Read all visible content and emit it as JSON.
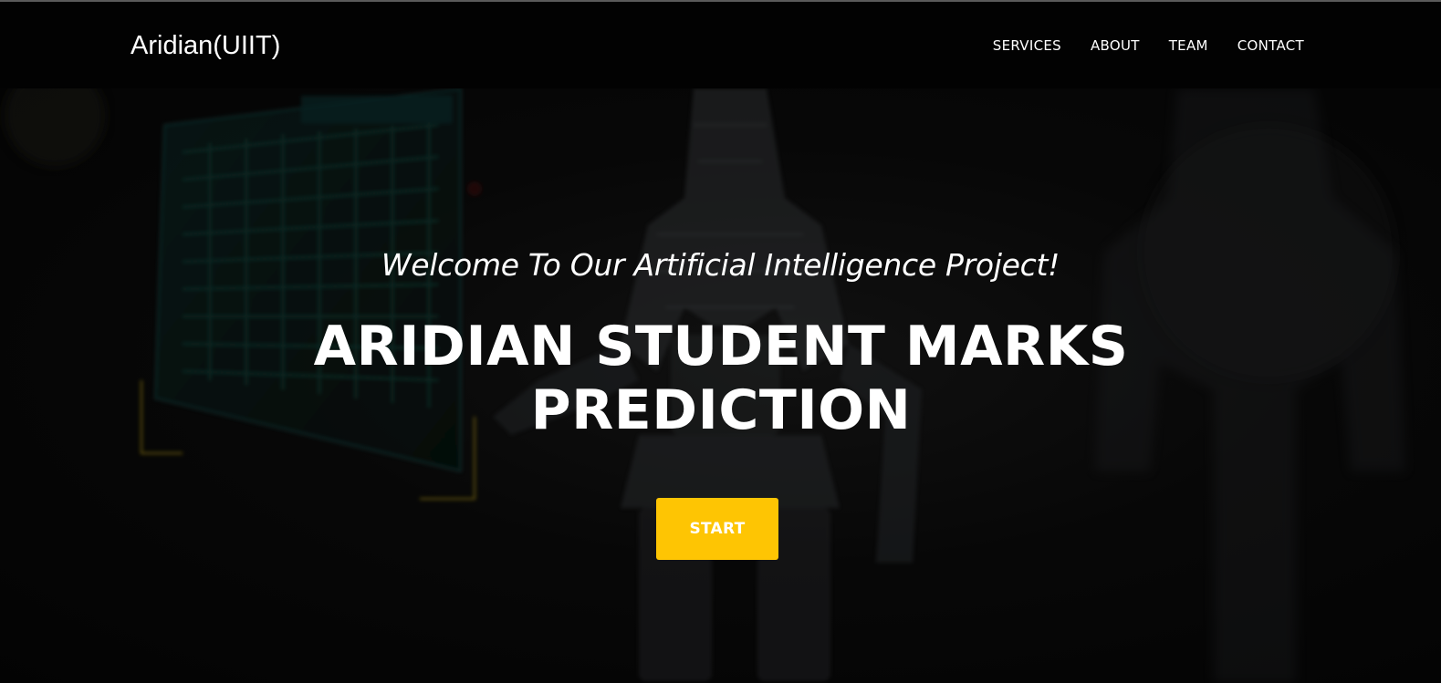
{
  "nav": {
    "brand": "Aridian(UIIT)",
    "links": [
      "SERVICES",
      "ABOUT",
      "TEAM",
      "CONTACT"
    ]
  },
  "hero": {
    "subheading": "Welcome To Our Artificial Intelligence Project!",
    "heading_line1": "ARIDIAN STUDENT MARKS",
    "heading_line2": "PREDICTION",
    "button_label": "START",
    "background_image": "robot-circuit-board-icon"
  },
  "colors": {
    "navbar_bg": "#020202",
    "accent": "#fec503",
    "text": "#ffffff"
  }
}
